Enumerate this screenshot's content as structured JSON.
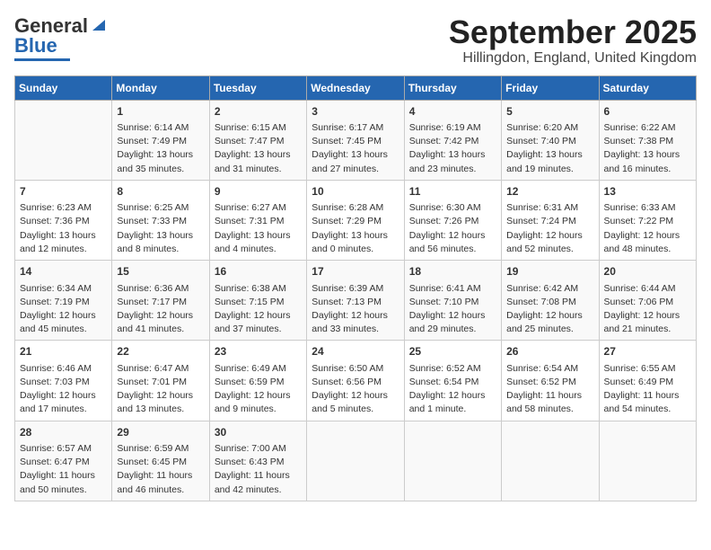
{
  "header": {
    "logo_general": "General",
    "logo_blue": "Blue",
    "month": "September 2025",
    "location": "Hillingdon, England, United Kingdom"
  },
  "days_of_week": [
    "Sunday",
    "Monday",
    "Tuesday",
    "Wednesday",
    "Thursday",
    "Friday",
    "Saturday"
  ],
  "weeks": [
    [
      {
        "day": "",
        "content": ""
      },
      {
        "day": "1",
        "content": "Sunrise: 6:14 AM\nSunset: 7:49 PM\nDaylight: 13 hours\nand 35 minutes."
      },
      {
        "day": "2",
        "content": "Sunrise: 6:15 AM\nSunset: 7:47 PM\nDaylight: 13 hours\nand 31 minutes."
      },
      {
        "day": "3",
        "content": "Sunrise: 6:17 AM\nSunset: 7:45 PM\nDaylight: 13 hours\nand 27 minutes."
      },
      {
        "day": "4",
        "content": "Sunrise: 6:19 AM\nSunset: 7:42 PM\nDaylight: 13 hours\nand 23 minutes."
      },
      {
        "day": "5",
        "content": "Sunrise: 6:20 AM\nSunset: 7:40 PM\nDaylight: 13 hours\nand 19 minutes."
      },
      {
        "day": "6",
        "content": "Sunrise: 6:22 AM\nSunset: 7:38 PM\nDaylight: 13 hours\nand 16 minutes."
      }
    ],
    [
      {
        "day": "7",
        "content": "Sunrise: 6:23 AM\nSunset: 7:36 PM\nDaylight: 13 hours\nand 12 minutes."
      },
      {
        "day": "8",
        "content": "Sunrise: 6:25 AM\nSunset: 7:33 PM\nDaylight: 13 hours\nand 8 minutes."
      },
      {
        "day": "9",
        "content": "Sunrise: 6:27 AM\nSunset: 7:31 PM\nDaylight: 13 hours\nand 4 minutes."
      },
      {
        "day": "10",
        "content": "Sunrise: 6:28 AM\nSunset: 7:29 PM\nDaylight: 13 hours\nand 0 minutes."
      },
      {
        "day": "11",
        "content": "Sunrise: 6:30 AM\nSunset: 7:26 PM\nDaylight: 12 hours\nand 56 minutes."
      },
      {
        "day": "12",
        "content": "Sunrise: 6:31 AM\nSunset: 7:24 PM\nDaylight: 12 hours\nand 52 minutes."
      },
      {
        "day": "13",
        "content": "Sunrise: 6:33 AM\nSunset: 7:22 PM\nDaylight: 12 hours\nand 48 minutes."
      }
    ],
    [
      {
        "day": "14",
        "content": "Sunrise: 6:34 AM\nSunset: 7:19 PM\nDaylight: 12 hours\nand 45 minutes."
      },
      {
        "day": "15",
        "content": "Sunrise: 6:36 AM\nSunset: 7:17 PM\nDaylight: 12 hours\nand 41 minutes."
      },
      {
        "day": "16",
        "content": "Sunrise: 6:38 AM\nSunset: 7:15 PM\nDaylight: 12 hours\nand 37 minutes."
      },
      {
        "day": "17",
        "content": "Sunrise: 6:39 AM\nSunset: 7:13 PM\nDaylight: 12 hours\nand 33 minutes."
      },
      {
        "day": "18",
        "content": "Sunrise: 6:41 AM\nSunset: 7:10 PM\nDaylight: 12 hours\nand 29 minutes."
      },
      {
        "day": "19",
        "content": "Sunrise: 6:42 AM\nSunset: 7:08 PM\nDaylight: 12 hours\nand 25 minutes."
      },
      {
        "day": "20",
        "content": "Sunrise: 6:44 AM\nSunset: 7:06 PM\nDaylight: 12 hours\nand 21 minutes."
      }
    ],
    [
      {
        "day": "21",
        "content": "Sunrise: 6:46 AM\nSunset: 7:03 PM\nDaylight: 12 hours\nand 17 minutes."
      },
      {
        "day": "22",
        "content": "Sunrise: 6:47 AM\nSunset: 7:01 PM\nDaylight: 12 hours\nand 13 minutes."
      },
      {
        "day": "23",
        "content": "Sunrise: 6:49 AM\nSunset: 6:59 PM\nDaylight: 12 hours\nand 9 minutes."
      },
      {
        "day": "24",
        "content": "Sunrise: 6:50 AM\nSunset: 6:56 PM\nDaylight: 12 hours\nand 5 minutes."
      },
      {
        "day": "25",
        "content": "Sunrise: 6:52 AM\nSunset: 6:54 PM\nDaylight: 12 hours\nand 1 minute."
      },
      {
        "day": "26",
        "content": "Sunrise: 6:54 AM\nSunset: 6:52 PM\nDaylight: 11 hours\nand 58 minutes."
      },
      {
        "day": "27",
        "content": "Sunrise: 6:55 AM\nSunset: 6:49 PM\nDaylight: 11 hours\nand 54 minutes."
      }
    ],
    [
      {
        "day": "28",
        "content": "Sunrise: 6:57 AM\nSunset: 6:47 PM\nDaylight: 11 hours\nand 50 minutes."
      },
      {
        "day": "29",
        "content": "Sunrise: 6:59 AM\nSunset: 6:45 PM\nDaylight: 11 hours\nand 46 minutes."
      },
      {
        "day": "30",
        "content": "Sunrise: 7:00 AM\nSunset: 6:43 PM\nDaylight: 11 hours\nand 42 minutes."
      },
      {
        "day": "",
        "content": ""
      },
      {
        "day": "",
        "content": ""
      },
      {
        "day": "",
        "content": ""
      },
      {
        "day": "",
        "content": ""
      }
    ]
  ]
}
